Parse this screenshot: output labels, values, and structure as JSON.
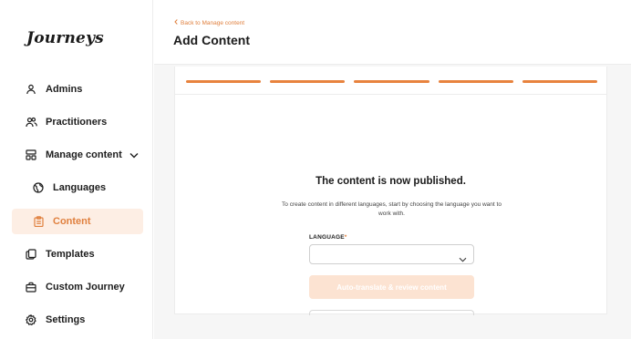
{
  "app": {
    "logo": "Journeys"
  },
  "sidebar": {
    "items": [
      {
        "label": "Admins",
        "icon": "user-icon"
      },
      {
        "label": "Practitioners",
        "icon": "users-icon"
      },
      {
        "label": "Manage content",
        "icon": "layout-icon"
      },
      {
        "label": "Languages",
        "icon": "globe-icon"
      },
      {
        "label": "Content",
        "icon": "clipboard-icon",
        "active": true
      },
      {
        "label": "Templates",
        "icon": "copy-icon"
      },
      {
        "label": "Custom Journey",
        "icon": "briefcase-icon"
      },
      {
        "label": "Settings",
        "icon": "gear-icon"
      }
    ]
  },
  "header": {
    "back_label": "Back to Manage content",
    "title": "Add Content"
  },
  "main": {
    "stepper_steps": 5,
    "published_title": "The content is now published.",
    "published_desc": "To create content in different languages, start by choosing the language you want to work with.",
    "language_label": "LANGUAGE",
    "required_mark": "*",
    "language_value": "",
    "translate_button": "Auto-translate & review content"
  },
  "colors": {
    "accent": "#e8833e",
    "active_bg": "#fdeee4",
    "disabled_button_bg": "#fce3d2",
    "page_bg": "#f6f6f6"
  }
}
